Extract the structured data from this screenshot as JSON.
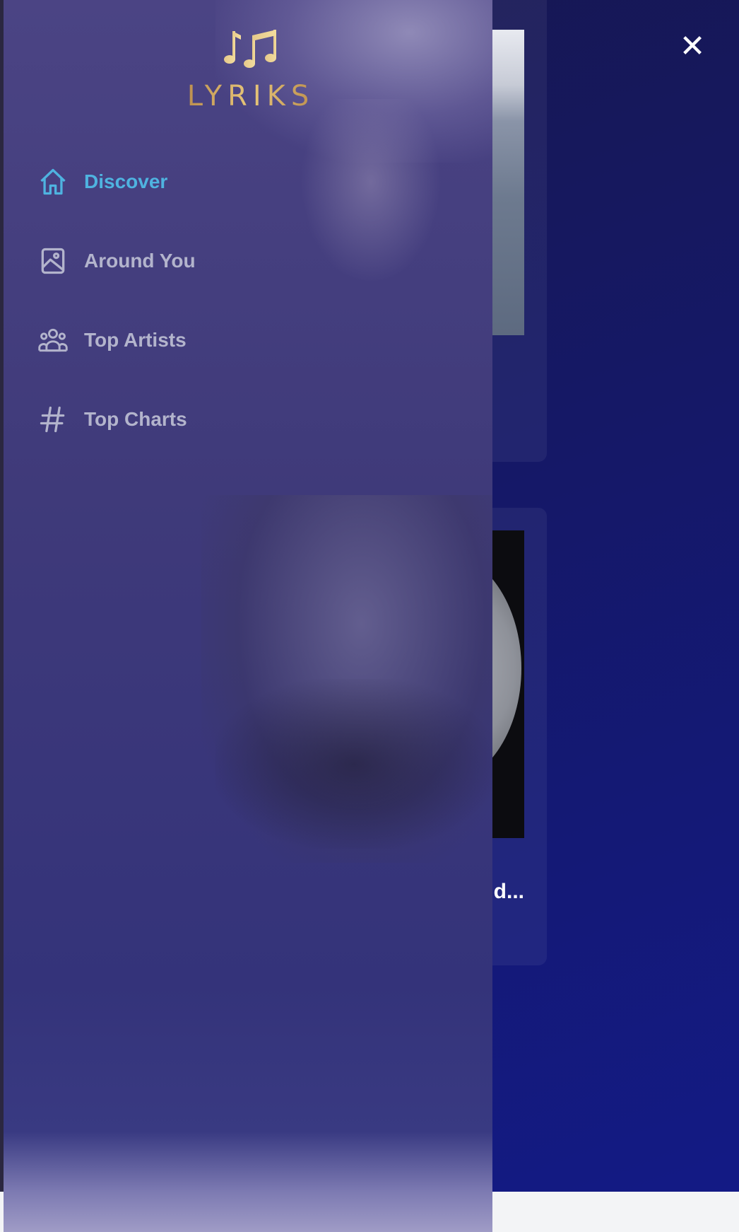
{
  "app": {
    "logo_text": "LYRIKS",
    "close_label": "✕"
  },
  "sidebar": {
    "items": [
      {
        "label": "Discover",
        "icon": "home-icon",
        "active": true
      },
      {
        "label": "Around You",
        "icon": "image-icon",
        "active": false
      },
      {
        "label": "Top Artists",
        "icon": "user-group-icon",
        "active": false
      },
      {
        "label": "Top Charts",
        "icon": "hashtag-icon",
        "active": false
      }
    ]
  },
  "background": {
    "cards": [
      {
        "title": ""
      },
      {
        "title": "d..."
      }
    ]
  },
  "colors": {
    "active": "#4fb3e0",
    "inactive": "#b3b4cc",
    "logo_gold": "#d6ad63",
    "sidebar_bg": "#433d80",
    "page_bg": "#141a80"
  }
}
